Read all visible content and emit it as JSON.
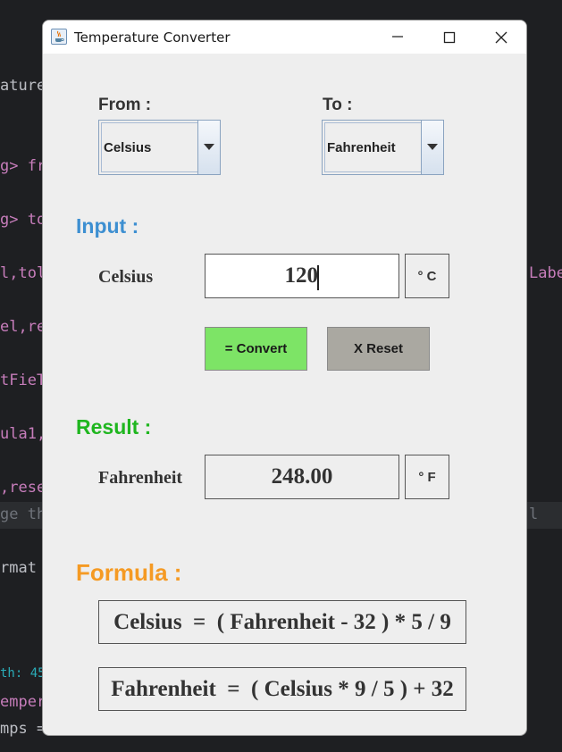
{
  "editor": {
    "lines": [
      "ature",
      "g> fr",
      "g> to",
      "l,tol",
      "el,re",
      "tFieT",
      "ula1,",
      ",rese",
      "ge th",
      "rmat",
      "th: 45",
      "emper",
      "mps ="
    ],
    "right_lines": [
      "Labe",
      "l"
    ]
  },
  "window": {
    "title": "Temperature Converter",
    "controls": {
      "minimize": "minimize",
      "maximize": "maximize",
      "close": "close"
    }
  },
  "from": {
    "label": "From :",
    "selected": "Celsius"
  },
  "to": {
    "label": "To :",
    "selected": "Fahrenheit"
  },
  "input": {
    "section_title": "Input :",
    "field_label": "Celsius",
    "value": "120",
    "unit": "° C"
  },
  "buttons": {
    "convert": "= Convert",
    "reset": "X  Reset"
  },
  "result": {
    "section_title": "Result :",
    "field_label": "Fahrenheit",
    "value": "248.00",
    "unit": "° F"
  },
  "formula": {
    "section_title": "Formula :",
    "line1": "Celsius  =  ( Fahrenheit - 32 ) * 5 / 9",
    "line2": "Fahrenheit  =  ( Celsius * 9 / 5 ) + 32"
  },
  "colors": {
    "input_title": "#3d8fd1",
    "result_title": "#1fb61f",
    "formula_title": "#f59a23",
    "convert_button": "#7de466",
    "reset_button": "#aaa8a1"
  }
}
